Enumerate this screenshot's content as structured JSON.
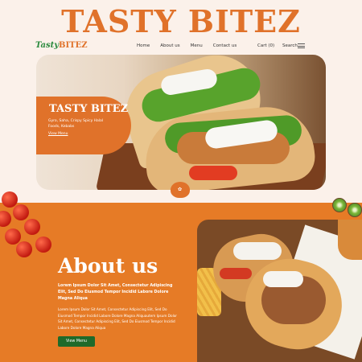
{
  "banner": {
    "title": "TASTY BITEZ"
  },
  "nav": {
    "logo_part1": "Tasty",
    "logo_part2": "BITEZ",
    "links": [
      "Home",
      "About us",
      "Menu",
      "Contact us"
    ],
    "cart": "Cart (0)",
    "search": "Search",
    "menu_icon": "hamburger-icon"
  },
  "hero": {
    "title": "TASTY BITEZ",
    "description": "Gyro, Saha, Crispy Spicy Halal Foods, Kebabs",
    "link": "View Menu",
    "badge_icon": "flower-icon"
  },
  "about": {
    "title": "About us",
    "lead": "Lorem Ipsum Dolor Sit Amet, Consectetur Adipiscing Elit, Sed Do Eiusmod Tempor Incidid Labore Dolore Magna Aliqua",
    "body": "Lorem Ipsum Dolor Sit Amet, Consectetur Adipiscing Elit, Sed Do Eiusmod Tempor Incidid Labore Dolore Magna Aliquautem Ipsum Dolor Sit Amet, Consectetur Adipiscing Elit, Sed Do Eiusmod Tempor Incidid Labore Dolore Magna Aliqua",
    "button": "View Menu"
  },
  "colors": {
    "brand_orange": "#e0722a",
    "section_orange": "#e67b26",
    "button_green": "#1f6a2a",
    "page_bg": "#fbf1ea"
  }
}
